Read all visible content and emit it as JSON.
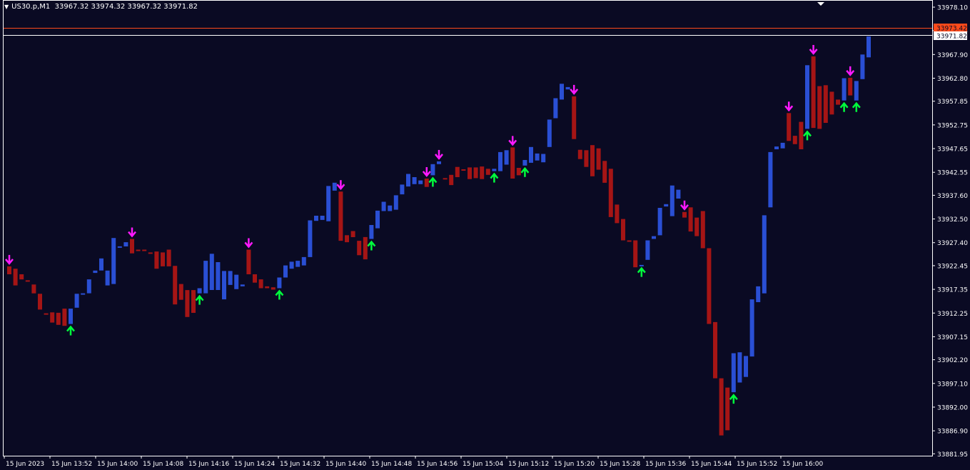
{
  "header": {
    "symbol_label": "US30.p,M1",
    "ohlc_text": "33967.32 33974.32 33967.32 33971.82",
    "menu_icon": "triangle-down-icon"
  },
  "colors": {
    "background": "#0a0a23",
    "bull": "#2a4fd4",
    "bear": "#a51515",
    "buy_arrow": "#00ff3c",
    "sell_arrow": "#ff19ff",
    "grid_frame": "#ffffff",
    "ask_line": "#ff4a1a",
    "bid_line": "#ffffff"
  },
  "price_labels": {
    "ask": "33973.42",
    "bid": "33971.82"
  },
  "chart_data": {
    "type": "bar",
    "title": "US30.p,M1",
    "ylim": [
      33880,
      33978.1
    ],
    "y_ticks": [
      "33978.10",
      "33973.05",
      "33967.90",
      "33962.80",
      "33957.85",
      "33952.75",
      "33947.65",
      "33942.55",
      "33937.60",
      "33932.50",
      "33927.40",
      "33922.45",
      "33917.35",
      "33912.25",
      "33907.15",
      "33902.20",
      "33897.10",
      "33892.00",
      "33886.90",
      "33881.95"
    ],
    "x_ticks": [
      "15 Jun 2023",
      "15 Jun 13:52",
      "15 Jun 14:00",
      "15 Jun 14:08",
      "15 Jun 14:16",
      "15 Jun 14:24",
      "15 Jun 14:32",
      "15 Jun 14:40",
      "15 Jun 14:48",
      "15 Jun 14:56",
      "15 Jun 15:04",
      "15 Jun 15:12",
      "15 Jun 15:20",
      "15 Jun 15:28",
      "15 Jun 15:36",
      "15 Jun 15:44",
      "15 Jun 15:52",
      "15 Jun 16:00"
    ],
    "bars": [
      {
        "dir": "down",
        "high": 33922.3,
        "low": 33920.6,
        "signal": "sell"
      },
      {
        "dir": "down",
        "high": 33921.8,
        "low": 33918.2
      },
      {
        "dir": "down",
        "high": 33920.6,
        "low": 33919.5
      },
      {
        "dir": "down",
        "high": 33919.3,
        "low": 33919.1
      },
      {
        "dir": "down",
        "high": 33918.4,
        "low": 33916.5
      },
      {
        "dir": "down",
        "high": 33916.4,
        "low": 33913.0
      },
      {
        "dir": "down",
        "high": 33912.2,
        "low": 33911.9
      },
      {
        "dir": "down",
        "high": 33912.4,
        "low": 33910.2
      },
      {
        "dir": "down",
        "high": 33912.3,
        "low": 33909.7
      },
      {
        "dir": "down",
        "high": 33913.2,
        "low": 33909.5
      },
      {
        "dir": "up",
        "high": 33913.2,
        "low": 33909.9,
        "signal": "buy"
      },
      {
        "dir": "up",
        "high": 33916.4,
        "low": 33913.4
      },
      {
        "dir": "up",
        "high": 33916.5,
        "low": 33916.3
      },
      {
        "dir": "up",
        "high": 33919.5,
        "low": 33916.5
      },
      {
        "dir": "up",
        "high": 33921.4,
        "low": 33920.9
      },
      {
        "dir": "up",
        "high": 33924.0,
        "low": 33921.4
      },
      {
        "dir": "up",
        "high": 33921.4,
        "low": 33918.2
      },
      {
        "dir": "up",
        "high": 33928.4,
        "low": 33918.5
      },
      {
        "dir": "up",
        "high": 33926.6,
        "low": 33926.3
      },
      {
        "dir": "up",
        "high": 33927.5,
        "low": 33926.6
      },
      {
        "dir": "down",
        "high": 33928.2,
        "low": 33925.1,
        "signal": "sell"
      },
      {
        "dir": "down",
        "high": 33925.9,
        "low": 33925.7
      },
      {
        "dir": "down",
        "high": 33925.9,
        "low": 33925.6
      },
      {
        "dir": "down",
        "high": 33925.3,
        "low": 33925.3
      },
      {
        "dir": "down",
        "high": 33925.5,
        "low": 33921.8
      },
      {
        "dir": "down",
        "high": 33925.3,
        "low": 33922.3
      },
      {
        "dir": "down",
        "high": 33925.9,
        "low": 33922.3
      },
      {
        "dir": "down",
        "high": 33922.4,
        "low": 33914.1
      },
      {
        "dir": "down",
        "high": 33918.5,
        "low": 33915.1
      },
      {
        "dir": "down",
        "high": 33917.2,
        "low": 33911.4
      },
      {
        "dir": "down",
        "high": 33917.2,
        "low": 33912.3
      },
      {
        "dir": "up",
        "high": 33917.6,
        "low": 33916.5,
        "signal": "buy"
      },
      {
        "dir": "up",
        "high": 33923.5,
        "low": 33916.5
      },
      {
        "dir": "up",
        "high": 33925.0,
        "low": 33917.2
      },
      {
        "dir": "up",
        "high": 33923.2,
        "low": 33917.2
      },
      {
        "dir": "up",
        "high": 33921.3,
        "low": 33915.2
      },
      {
        "dir": "up",
        "high": 33921.3,
        "low": 33918.3
      },
      {
        "dir": "up",
        "high": 33920.5,
        "low": 33917.4
      },
      {
        "dir": "up",
        "high": 33918.4,
        "low": 33918.0
      },
      {
        "dir": "down",
        "high": 33925.9,
        "low": 33920.6,
        "signal": "sell"
      },
      {
        "dir": "down",
        "high": 33920.6,
        "low": 33918.8
      },
      {
        "dir": "down",
        "high": 33919.5,
        "low": 33917.6
      },
      {
        "dir": "down",
        "high": 33918.0,
        "low": 33917.6
      },
      {
        "dir": "down",
        "high": 33917.8,
        "low": 33917.3
      },
      {
        "dir": "up",
        "high": 33919.9,
        "low": 33917.6,
        "signal": "buy"
      },
      {
        "dir": "up",
        "high": 33922.5,
        "low": 33919.9
      },
      {
        "dir": "up",
        "high": 33923.3,
        "low": 33921.8
      },
      {
        "dir": "up",
        "high": 33923.5,
        "low": 33922.2
      },
      {
        "dir": "up",
        "high": 33924.3,
        "low": 33922.5
      },
      {
        "dir": "up",
        "high": 33932.2,
        "low": 33924.3
      },
      {
        "dir": "up",
        "high": 33933.2,
        "low": 33932.1
      },
      {
        "dir": "up",
        "high": 33933.2,
        "low": 33932.3
      },
      {
        "dir": "up",
        "high": 33939.6,
        "low": 33932.0
      },
      {
        "dir": "up",
        "high": 33940.3,
        "low": 33938.6
      },
      {
        "dir": "down",
        "high": 33938.4,
        "low": 33927.8,
        "signal": "sell"
      },
      {
        "dir": "down",
        "high": 33929.0,
        "low": 33927.5
      },
      {
        "dir": "down",
        "high": 33929.9,
        "low": 33928.6
      },
      {
        "dir": "down",
        "high": 33927.8,
        "low": 33924.7
      },
      {
        "dir": "down",
        "high": 33928.6,
        "low": 33923.8
      },
      {
        "dir": "up",
        "high": 33931.2,
        "low": 33928.2,
        "signal": "buy"
      },
      {
        "dir": "up",
        "high": 33934.3,
        "low": 33930.5
      },
      {
        "dir": "up",
        "high": 33936.2,
        "low": 33934.2
      },
      {
        "dir": "up",
        "high": 33935.4,
        "low": 33934.2
      },
      {
        "dir": "up",
        "high": 33937.6,
        "low": 33934.5
      },
      {
        "dir": "up",
        "high": 33939.9,
        "low": 33937.8
      },
      {
        "dir": "up",
        "high": 33942.2,
        "low": 33939.5
      },
      {
        "dir": "up",
        "high": 33941.5,
        "low": 33940.0
      },
      {
        "dir": "up",
        "high": 33940.8,
        "low": 33940.0
      },
      {
        "dir": "down",
        "high": 33941.2,
        "low": 33939.4,
        "signal": "sell"
      },
      {
        "dir": "up",
        "high": 33944.3,
        "low": 33941.9,
        "signal": "buy"
      },
      {
        "dir": "up",
        "high": 33944.9,
        "low": 33944.3,
        "signal": "sell"
      },
      {
        "dir": "down",
        "high": 33941.3,
        "low": 33941.1
      },
      {
        "dir": "down",
        "high": 33942.0,
        "low": 33939.8
      },
      {
        "dir": "down",
        "high": 33943.7,
        "low": 33941.5
      },
      {
        "dir": "down",
        "high": 33943.2,
        "low": 33943.0
      },
      {
        "dir": "down",
        "high": 33943.6,
        "low": 33941.1
      },
      {
        "dir": "down",
        "high": 33943.6,
        "low": 33941.3
      },
      {
        "dir": "down",
        "high": 33943.8,
        "low": 33941.1
      },
      {
        "dir": "down",
        "high": 33943.3,
        "low": 33942.0
      },
      {
        "dir": "up",
        "high": 33943.3,
        "low": 33942.8,
        "signal": "buy"
      },
      {
        "dir": "up",
        "high": 33946.9,
        "low": 33942.8
      },
      {
        "dir": "up",
        "high": 33947.3,
        "low": 33944.2
      },
      {
        "dir": "down",
        "high": 33947.9,
        "low": 33941.2,
        "signal": "sell"
      },
      {
        "dir": "down",
        "high": 33943.5,
        "low": 33941.9
      },
      {
        "dir": "up",
        "high": 33945.2,
        "low": 33944.0,
        "signal": "buy"
      },
      {
        "dir": "up",
        "high": 33948.0,
        "low": 33944.6
      },
      {
        "dir": "up",
        "high": 33946.6,
        "low": 33945.1
      },
      {
        "dir": "up",
        "high": 33946.5,
        "low": 33944.7
      },
      {
        "dir": "up",
        "high": 33953.9,
        "low": 33948.0
      },
      {
        "dir": "up",
        "high": 33958.5,
        "low": 33954.2
      },
      {
        "dir": "up",
        "high": 33961.6,
        "low": 33958.2
      },
      {
        "dir": "up",
        "high": 33960.9,
        "low": 33960.4
      },
      {
        "dir": "down",
        "high": 33958.9,
        "low": 33949.7,
        "signal": "sell"
      },
      {
        "dir": "down",
        "high": 33947.4,
        "low": 33945.4
      },
      {
        "dir": "down",
        "high": 33947.3,
        "low": 33943.7
      },
      {
        "dir": "down",
        "high": 33948.4,
        "low": 33941.7
      },
      {
        "dir": "down",
        "high": 33947.7,
        "low": 33943.1
      },
      {
        "dir": "down",
        "high": 33945.0,
        "low": 33940.3
      },
      {
        "dir": "down",
        "high": 33943.3,
        "low": 33932.9
      },
      {
        "dir": "down",
        "high": 33935.6,
        "low": 33931.6
      },
      {
        "dir": "down",
        "high": 33932.5,
        "low": 33927.9
      },
      {
        "dir": "down",
        "high": 33927.9,
        "low": 33927.6
      },
      {
        "dir": "down",
        "high": 33927.9,
        "low": 33922.1
      },
      {
        "dir": "up",
        "high": 33922.6,
        "low": 33922.5,
        "signal": "buy"
      },
      {
        "dir": "up",
        "high": 33927.9,
        "low": 33923.7
      },
      {
        "dir": "up",
        "high": 33928.8,
        "low": 33928.2
      },
      {
        "dir": "up",
        "high": 33934.9,
        "low": 33929.0
      },
      {
        "dir": "up",
        "high": 33935.7,
        "low": 33935.2
      },
      {
        "dir": "up",
        "high": 33939.7,
        "low": 33933.1
      },
      {
        "dir": "up",
        "high": 33938.8,
        "low": 33936.9
      },
      {
        "dir": "down",
        "high": 33934.0,
        "low": 33932.8,
        "signal": "sell"
      },
      {
        "dir": "down",
        "high": 33935.0,
        "low": 33929.8
      },
      {
        "dir": "down",
        "high": 33932.8,
        "low": 33928.8
      },
      {
        "dir": "down",
        "high": 33934.2,
        "low": 33926.2
      },
      {
        "dir": "down",
        "high": 33926.2,
        "low": 33909.9
      },
      {
        "dir": "down",
        "high": 33910.3,
        "low": 33898.2
      },
      {
        "dir": "down",
        "high": 33898.2,
        "low": 33885.9
      },
      {
        "dir": "down",
        "high": 33896.2,
        "low": 33887.0
      },
      {
        "dir": "up",
        "high": 33903.6,
        "low": 33895.2,
        "signal": "buy"
      },
      {
        "dir": "up",
        "high": 33903.8,
        "low": 33897.3
      },
      {
        "dir": "up",
        "high": 33903.0,
        "low": 33898.5
      },
      {
        "dir": "up",
        "high": 33915.2,
        "low": 33902.9
      },
      {
        "dir": "up",
        "high": 33918.0,
        "low": 33914.6
      },
      {
        "dir": "up",
        "high": 33933.3,
        "low": 33916.5
      },
      {
        "dir": "up",
        "high": 33946.9,
        "low": 33935.0
      },
      {
        "dir": "up",
        "high": 33948.1,
        "low": 33947.5
      },
      {
        "dir": "up",
        "high": 33948.9,
        "low": 33947.7
      },
      {
        "dir": "down",
        "high": 33955.3,
        "low": 33949.3,
        "signal": "sell"
      },
      {
        "dir": "down",
        "high": 33950.4,
        "low": 33948.6
      },
      {
        "dir": "down",
        "high": 33953.4,
        "low": 33947.5
      },
      {
        "dir": "up",
        "high": 33965.6,
        "low": 33951.9,
        "signal": "buy"
      },
      {
        "dir": "down",
        "high": 33967.5,
        "low": 33952.1,
        "signal": "sell"
      },
      {
        "dir": "down",
        "high": 33961.1,
        "low": 33951.9
      },
      {
        "dir": "down",
        "high": 33961.3,
        "low": 33953.2
      },
      {
        "dir": "down",
        "high": 33959.9,
        "low": 33955.0
      },
      {
        "dir": "down",
        "high": 33958.2,
        "low": 33957.1
      },
      {
        "dir": "up",
        "high": 33962.8,
        "low": 33958.0,
        "signal": "buy"
      },
      {
        "dir": "down",
        "high": 33962.9,
        "low": 33959.1,
        "signal": "sell"
      },
      {
        "dir": "up",
        "high": 33962.2,
        "low": 33958.0,
        "signal": "buy"
      },
      {
        "dir": "up",
        "high": 33967.9,
        "low": 33962.6
      },
      {
        "dir": "up",
        "high": 33971.8,
        "low": 33967.3
      }
    ]
  }
}
